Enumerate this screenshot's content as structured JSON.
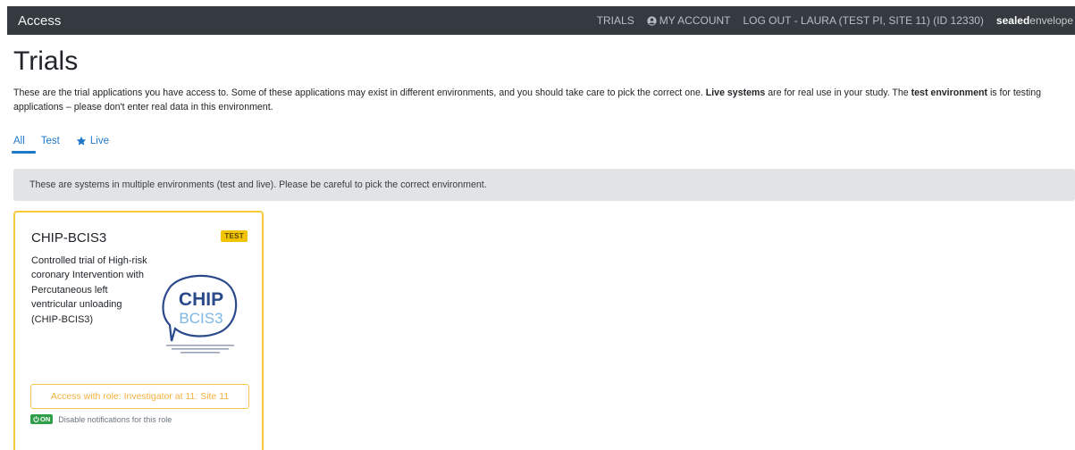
{
  "navbar": {
    "brand": "Access",
    "links": {
      "trials": "TRIALS",
      "my_account": "MY ACCOUNT",
      "logout": "LOG OUT - LAURA (TEST PI, SITE 11) (ID 12330)"
    },
    "logo_bold": "sealed",
    "logo_light": "envelope"
  },
  "page": {
    "title": "Trials",
    "intro_1": "These are the trial applications you have access to. Some of these applications may exist in different environments, and you should take care to pick the correct one. ",
    "intro_bold_1": "Live systems",
    "intro_2": " are for real use in your study. The ",
    "intro_bold_2": "test environment",
    "intro_3": " is for testing applications – please don't enter real data in this environment."
  },
  "tabs": [
    {
      "label": "All"
    },
    {
      "label": "Test"
    },
    {
      "label": "Live"
    }
  ],
  "notice": "These are systems in multiple environments (test and live). Please be careful to pick the correct environment.",
  "card": {
    "title": "CHIP-BCIS3",
    "badge": "TEST",
    "description": "Controlled trial of High-risk coronary Intervention with Percutaneous left ventricular unloading (CHIP-BCIS3)",
    "logo_top": "CHIP",
    "logo_bottom": "BCIS3",
    "role_button": "Access with role: Investigator at 11: Site 11",
    "notif_badge": "ON",
    "notif_text": "Disable notifications for this role"
  },
  "colors": {
    "navbar_bg": "#343a40",
    "link_blue": "#1f78c8",
    "card_border": "#f5cb3c",
    "test_badge": "#f2c300",
    "on_badge": "#2e9e48",
    "logo_blue": "#2b4a8b",
    "logo_light_blue": "#7fb6e3"
  }
}
